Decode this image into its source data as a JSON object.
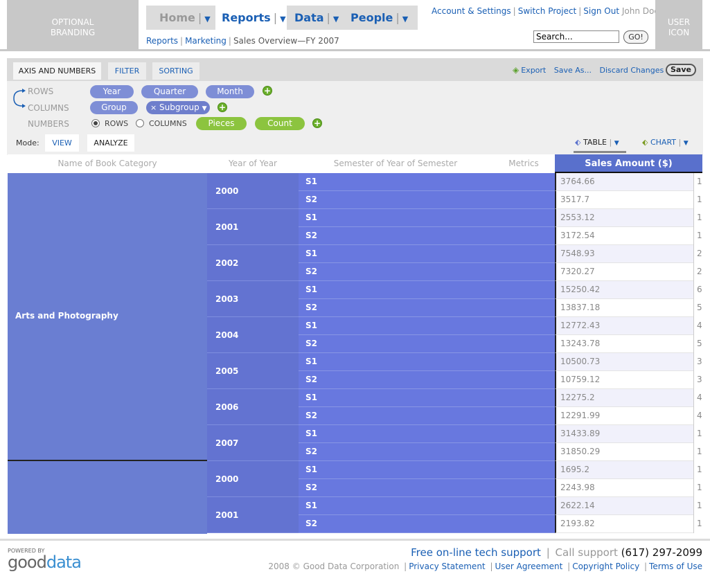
{
  "header": {
    "branding": [
      "OPTIONAL",
      "BRANDING"
    ],
    "user_icon": [
      "USER",
      "ICON"
    ],
    "nav": [
      {
        "label": "Home",
        "sep": "|",
        "caret": "▼"
      },
      {
        "label": "Reports",
        "sep": "|",
        "caret": "▼"
      },
      {
        "label": "Data",
        "sep": "|",
        "caret": "▼"
      },
      {
        "label": "People",
        "sep": "|",
        "caret": "▼"
      }
    ],
    "breadcrumb": [
      "Reports",
      "Marketing",
      "Sales Overview—FY 2007"
    ],
    "top_links": [
      "Account & Settings",
      "Switch Project",
      "Sign Out"
    ],
    "user_name": "John Doe",
    "search_value": "Search...",
    "go_label": "GO!"
  },
  "panel": {
    "tabs": [
      "AXIS AND NUMBERS",
      "FILTER",
      "SORTING"
    ],
    "actions": [
      "Export",
      "Save As...",
      "Discard Changes"
    ],
    "save_label": "Save",
    "rows_label": "ROWS",
    "columns_label": "COLUMNS",
    "numbers_label": "NUMBERS",
    "row_chips": [
      "Year",
      "Quarter",
      "Month"
    ],
    "column_chips": [
      "Group",
      "Subgroup"
    ],
    "subgroup_x": "×",
    "subgroup_caret": "▼",
    "radio_rows": "ROWS",
    "radio_columns": "COLUMNS",
    "number_chips": [
      "Pieces",
      "Count"
    ],
    "plus": "+",
    "mode_label": "Mode:",
    "mode_tabs": [
      "VIEW",
      "ANALYZE"
    ],
    "view_toggle": {
      "table": "TABLE",
      "chart": "CHART",
      "caret": "▼",
      "sep": "|"
    }
  },
  "table": {
    "headers": [
      "Name of Book Category",
      "Year of Year",
      "Semester of Year of Semester",
      "Metrics",
      "Sales Amount ($)"
    ],
    "category": "Arts and Photography",
    "years": [
      "2000",
      "2001",
      "2002",
      "2003",
      "2004",
      "2005",
      "2006",
      "2007",
      "2000",
      "2001"
    ],
    "semesters": [
      "S1",
      "S2"
    ],
    "values": [
      "3764.66",
      "3517.7",
      "2553.12",
      "3172.54",
      "7548.93",
      "7320.27",
      "15250.42",
      "13837.18",
      "12772.43",
      "13243.78",
      "10500.73",
      "10759.12",
      "12275.2",
      "12291.99",
      "31433.89",
      "31850.29",
      "1695.2",
      "2243.98",
      "2622.14",
      "2193.82"
    ],
    "extra_col": [
      "1",
      "1",
      "1",
      "1",
      "2",
      "2",
      "6",
      "5",
      "4",
      "5",
      "3",
      "3",
      "4",
      "4",
      "1",
      "1",
      "1",
      "1",
      "1",
      "1"
    ]
  },
  "footer": {
    "powered_by": "POWERED BY",
    "logo_good": "good",
    "logo_data": "data",
    "free_support": "Free on-line tech support",
    "call_support": "Call support",
    "phone": "(617) 297-2099",
    "copyright": "2008 © Good Data Corporation",
    "links": [
      "Privacy Statement",
      "User Agreement",
      "Copyright Policy",
      "Terms of Use"
    ]
  },
  "colors": {
    "accent": "#1a5fb4",
    "category_fill": "#6a7ed2",
    "row_fill": "#6878df",
    "chip_blue": "#7e8ed6",
    "chip_green": "#8cc43f"
  }
}
